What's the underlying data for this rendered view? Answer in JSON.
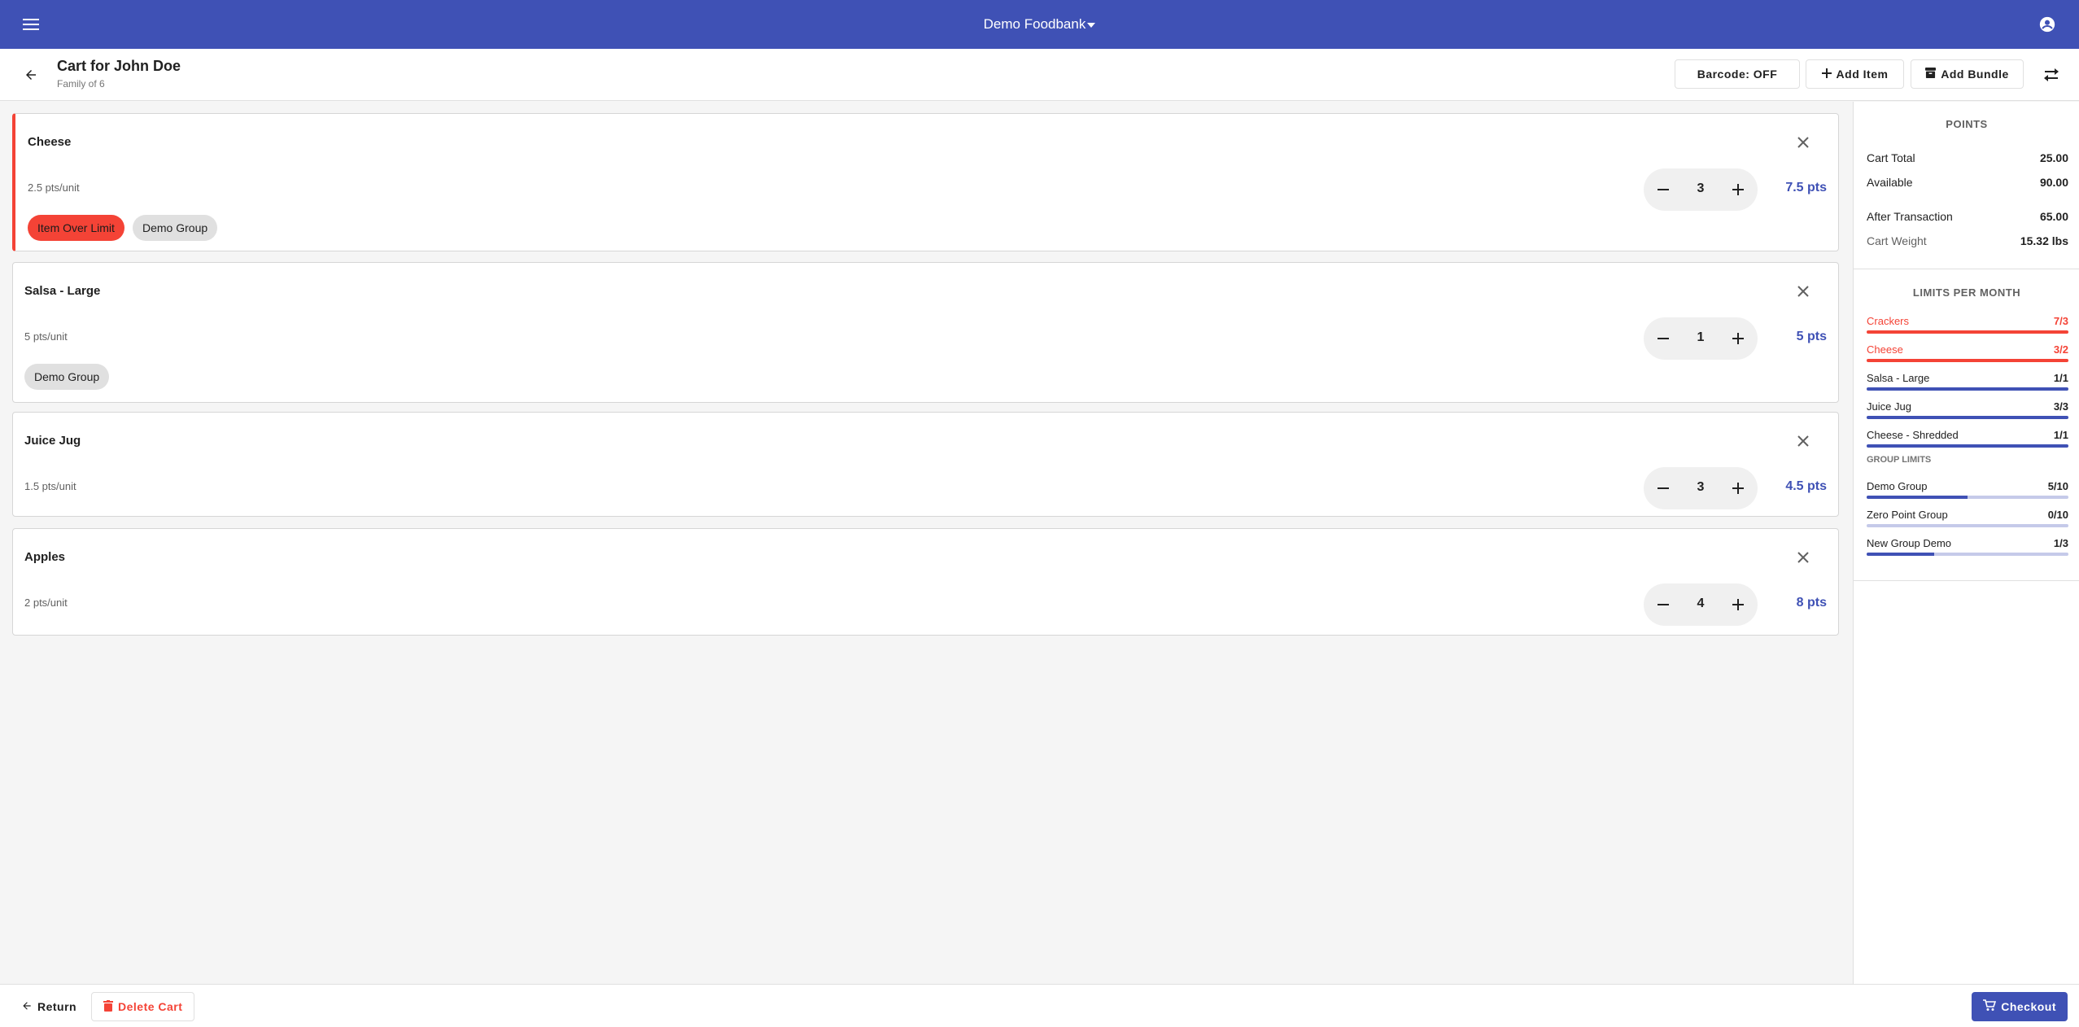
{
  "appbar": {
    "title": "Demo Foodbank",
    "menu_icon": "menu-icon",
    "account_icon": "account-circle-icon"
  },
  "header": {
    "title": "Cart for John Doe",
    "subtitle": "Family of 6",
    "barcode_label": "Barcode: OFF",
    "add_item_label": "Add Item",
    "add_bundle_label": "Add Bundle"
  },
  "items": [
    {
      "name": "Cheese",
      "rate": "2.5 pts/unit",
      "qty": "3",
      "pts": "7.5 pts",
      "chips": [
        "Item Over Limit",
        "Demo Group"
      ]
    },
    {
      "name": "Salsa - Large",
      "rate": "5 pts/unit",
      "qty": "1",
      "pts": "5 pts",
      "chips": [
        "Demo Group"
      ]
    },
    {
      "name": "Juice Jug",
      "rate": "1.5 pts/unit",
      "qty": "3",
      "pts": "4.5 pts"
    },
    {
      "name": "Apples",
      "rate": "2 pts/unit",
      "qty": "4",
      "pts": "8 pts"
    }
  ],
  "points": {
    "heading": "POINTS",
    "cart_total_label": "Cart Total",
    "cart_total": "25.00",
    "available_label": "Available",
    "available": "90.00",
    "after_label": "After Transaction",
    "after": "65.00",
    "weight_label": "Cart Weight",
    "weight": "15.32 lbs"
  },
  "limits": {
    "heading": "LIMITS PER MONTH",
    "items": [
      {
        "name": "Crackers",
        "value": "7/3",
        "fraction": 1.0,
        "over": true
      },
      {
        "name": "Cheese",
        "value": "3/2",
        "fraction": 1.0,
        "over": true
      },
      {
        "name": "Salsa - Large",
        "value": "1/1",
        "fraction": 1.0
      },
      {
        "name": "Juice Jug",
        "value": "3/3",
        "fraction": 1.0
      },
      {
        "name": "Cheese - Shredded",
        "value": "1/1",
        "fraction": 1.0
      }
    ],
    "group_heading": "GROUP LIMITS",
    "groups": [
      {
        "name": "Demo Group",
        "value": "5/10",
        "fraction": 0.5
      },
      {
        "name": "Zero Point Group",
        "value": "0/10",
        "fraction": 0.0
      },
      {
        "name": "New Group Demo",
        "value": "1/3",
        "fraction": 0.333
      }
    ]
  },
  "footer": {
    "return_label": "Return",
    "delete_label": "Delete Cart",
    "checkout_label": "Checkout"
  },
  "colors": {
    "primary": "#3f51b5",
    "danger": "#f44336"
  }
}
